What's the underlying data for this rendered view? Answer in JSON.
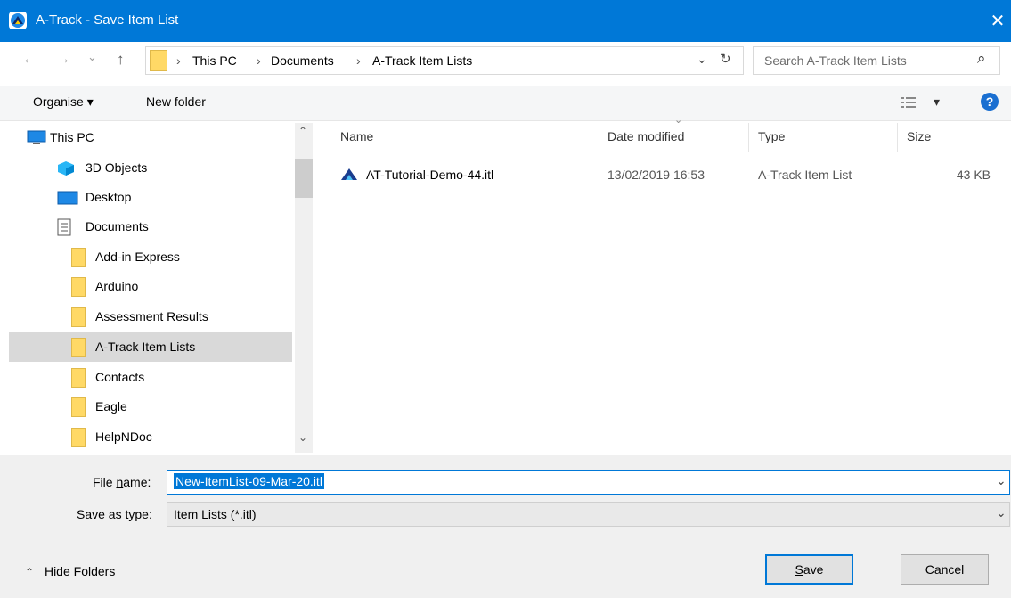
{
  "window": {
    "title": "A-Track - Save Item List",
    "close_glyph": "✕"
  },
  "nav": {
    "back_glyph": "←",
    "forward_glyph": "→",
    "recent_glyph": "⌄",
    "up_glyph": "↑",
    "breadcrumb": [
      "This PC",
      "Documents",
      "A-Track Item Lists"
    ],
    "separator": "›",
    "dropdown_glyph": "⌄",
    "refresh_glyph": "↻",
    "search_placeholder": "Search A-Track Item Lists",
    "search_glyph": "⌕"
  },
  "toolbar": {
    "organise_label": "Organise ▾",
    "new_folder_label": "New folder",
    "view_glyph": "▾",
    "help_glyph": "?"
  },
  "sidebar": {
    "items": [
      {
        "label": "This PC",
        "icon": "pc-icon"
      },
      {
        "label": "3D Objects",
        "icon": "3d-objects-icon"
      },
      {
        "label": "Desktop",
        "icon": "desktop-icon"
      },
      {
        "label": "Documents",
        "icon": "documents-icon"
      },
      {
        "label": "Add-in Express",
        "icon": "folder-icon"
      },
      {
        "label": "Arduino",
        "icon": "folder-icon"
      },
      {
        "label": "Assessment Results",
        "icon": "folder-icon"
      },
      {
        "label": "A-Track Item Lists",
        "icon": "folder-icon",
        "selected": true
      },
      {
        "label": "Contacts",
        "icon": "folder-icon"
      },
      {
        "label": "Eagle",
        "icon": "folder-icon"
      },
      {
        "label": "HelpNDoc",
        "icon": "folder-icon"
      }
    ],
    "scroll_up": "⌃",
    "scroll_down": "⌄"
  },
  "filelist": {
    "columns": [
      "Name",
      "Date modified",
      "Type",
      "Size"
    ],
    "sort_glyph": "⌄",
    "rows": [
      {
        "name": "AT-Tutorial-Demo-44.itl",
        "date": "13/02/2019 16:53",
        "type": "A-Track Item List",
        "size": "43 KB"
      }
    ]
  },
  "form": {
    "filename_label": "File name:",
    "filename_value": "New-ItemList-09-Mar-20.itl",
    "savetype_label": "Save as type:",
    "savetype_value": "Item Lists (*.itl)",
    "dropdown_glyph": "⌄"
  },
  "footer": {
    "hide_folders_glyph": "⌃",
    "hide_folders_label": "Hide Folders",
    "save_label": "Save",
    "cancel_label": "Cancel"
  },
  "colors": {
    "titlebar": "#0078d7",
    "selection": "#0078d7",
    "folder": "#ffd966"
  }
}
